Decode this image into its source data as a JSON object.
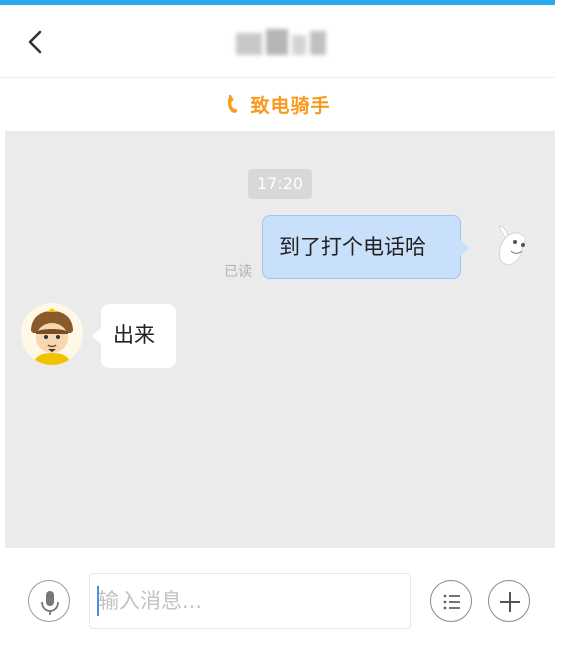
{
  "header": {
    "back_icon": "chevron-left-icon",
    "title_blurred": true
  },
  "call_bar": {
    "icon": "phone-icon",
    "label": "致电骑手",
    "color": "#f79a1e"
  },
  "chat": {
    "timestamp": "17:20",
    "messages": [
      {
        "direction": "outgoing",
        "text": "到了打个电话哈",
        "status": "已读",
        "avatar": "user-avatar"
      },
      {
        "direction": "incoming",
        "text": "出来",
        "avatar": "rider-avatar"
      }
    ]
  },
  "input_bar": {
    "voice_icon": "microphone-icon",
    "placeholder": "输入消息...",
    "value": "",
    "menu_icon": "list-menu-icon",
    "add_icon": "plus-icon"
  },
  "colors": {
    "accent_blue": "#2aa8f0",
    "bubble_out": "#c9e0fb",
    "chat_bg": "#ebebeb"
  }
}
